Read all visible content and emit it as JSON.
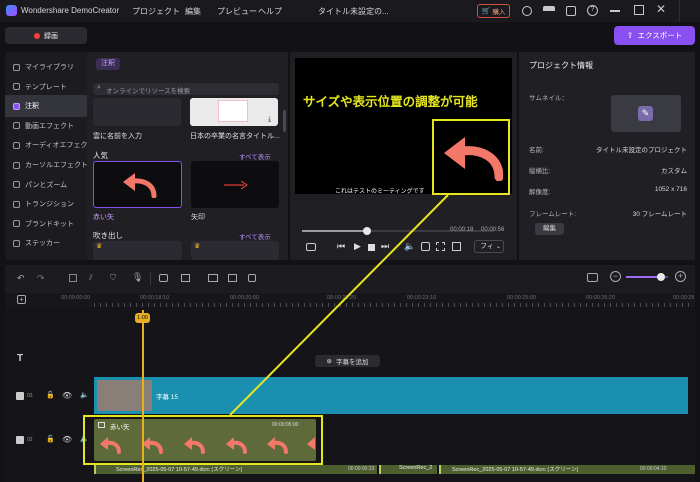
{
  "titlebar": {
    "app_name": "Wondershare DemoCreator",
    "menus": [
      "プロジェクト",
      "編集",
      "プレビュー",
      "ヘルプ"
    ],
    "project_title": "タイトル未設定の...",
    "buy_label": "購入"
  },
  "toolbar": {
    "record_label": "録画",
    "export_label": "エクスポート"
  },
  "sidebar": {
    "items": [
      {
        "label": "マイライブラリ",
        "icon": "library-icon"
      },
      {
        "label": "テンプレート",
        "icon": "template-icon"
      },
      {
        "label": "注釈",
        "icon": "annotation-icon",
        "active": true
      },
      {
        "label": "動画エフェクト",
        "icon": "video-effect-icon"
      },
      {
        "label": "オーディオエフェクト",
        "icon": "audio-effect-icon"
      },
      {
        "label": "カーソルエフェクト",
        "icon": "cursor-effect-icon"
      },
      {
        "label": "パンとズーム",
        "icon": "pan-zoom-icon"
      },
      {
        "label": "トランジション",
        "icon": "transition-icon"
      },
      {
        "label": "ブランドキット",
        "icon": "brand-kit-icon"
      },
      {
        "label": "ステッカー",
        "icon": "sticker-icon"
      }
    ]
  },
  "library": {
    "tab_label": "注釈",
    "search_placeholder": "オンラインでリソースを検索",
    "top_items": [
      "雲に名前を入力",
      "日本の卒業の名言タイトル..."
    ],
    "popular_title": "人気",
    "popular_more": "すべて表示",
    "popular_items": [
      "赤い矢",
      "矢印"
    ],
    "bubble_title": "吹き出し",
    "bubble_more": "すべて表示"
  },
  "preview": {
    "overlay_text": "サイズや表示位置の調整が可能",
    "subtitle_text": "これはテストのミーティングです",
    "current_time": "00:00:18",
    "total_time": "00:00:56",
    "progress": 0.33,
    "fit_label": "フィ"
  },
  "project_info": {
    "title": "プロジェクト情報",
    "thumbnail_label": "サムネイル：",
    "rows": [
      {
        "label": "名前:",
        "value": "タイトル未設定のプロジェクト"
      },
      {
        "label": "縦横比:",
        "value": "カスタム"
      },
      {
        "label": "解像度:",
        "value": "1052 x 716"
      },
      {
        "label": "フレームレート:",
        "value": "30 フレームレート"
      }
    ],
    "edit_label": "編集"
  },
  "timeline": {
    "ruler_ticks": [
      "00:00:00:00",
      "00:00:18:10",
      "00:00:20:00",
      "00:00:21:20",
      "00:00:23:10",
      "00:00:25:00",
      "00:00:26:20",
      "00:00:28"
    ],
    "playhead_label": "1:00",
    "add_subtitle_label": "字幕を追加",
    "track1_number": "03",
    "track2_number": "02",
    "clip1_label": "字幕 15",
    "clip2_label": "赤い矢",
    "clip2_time": "00:00:05:00",
    "bottom_clips": [
      "ScreenRec_2025-05-07 10-57-49.dcrc (スクリーン)",
      "ScreenRec_2",
      "ScreenRec_2025-05-07 10-57-49.dcrc (スクリーン)"
    ],
    "bottom_clip_times": [
      "00:00:00:23",
      "00:00:04:10"
    ]
  },
  "colors": {
    "accent": "#8a4ff0",
    "highlight": "#e6e61e",
    "arrow": "#f3786a",
    "clip_blue": "#1a8fb0",
    "clip_green": "#5f6a3a",
    "playhead": "#e8b020"
  }
}
